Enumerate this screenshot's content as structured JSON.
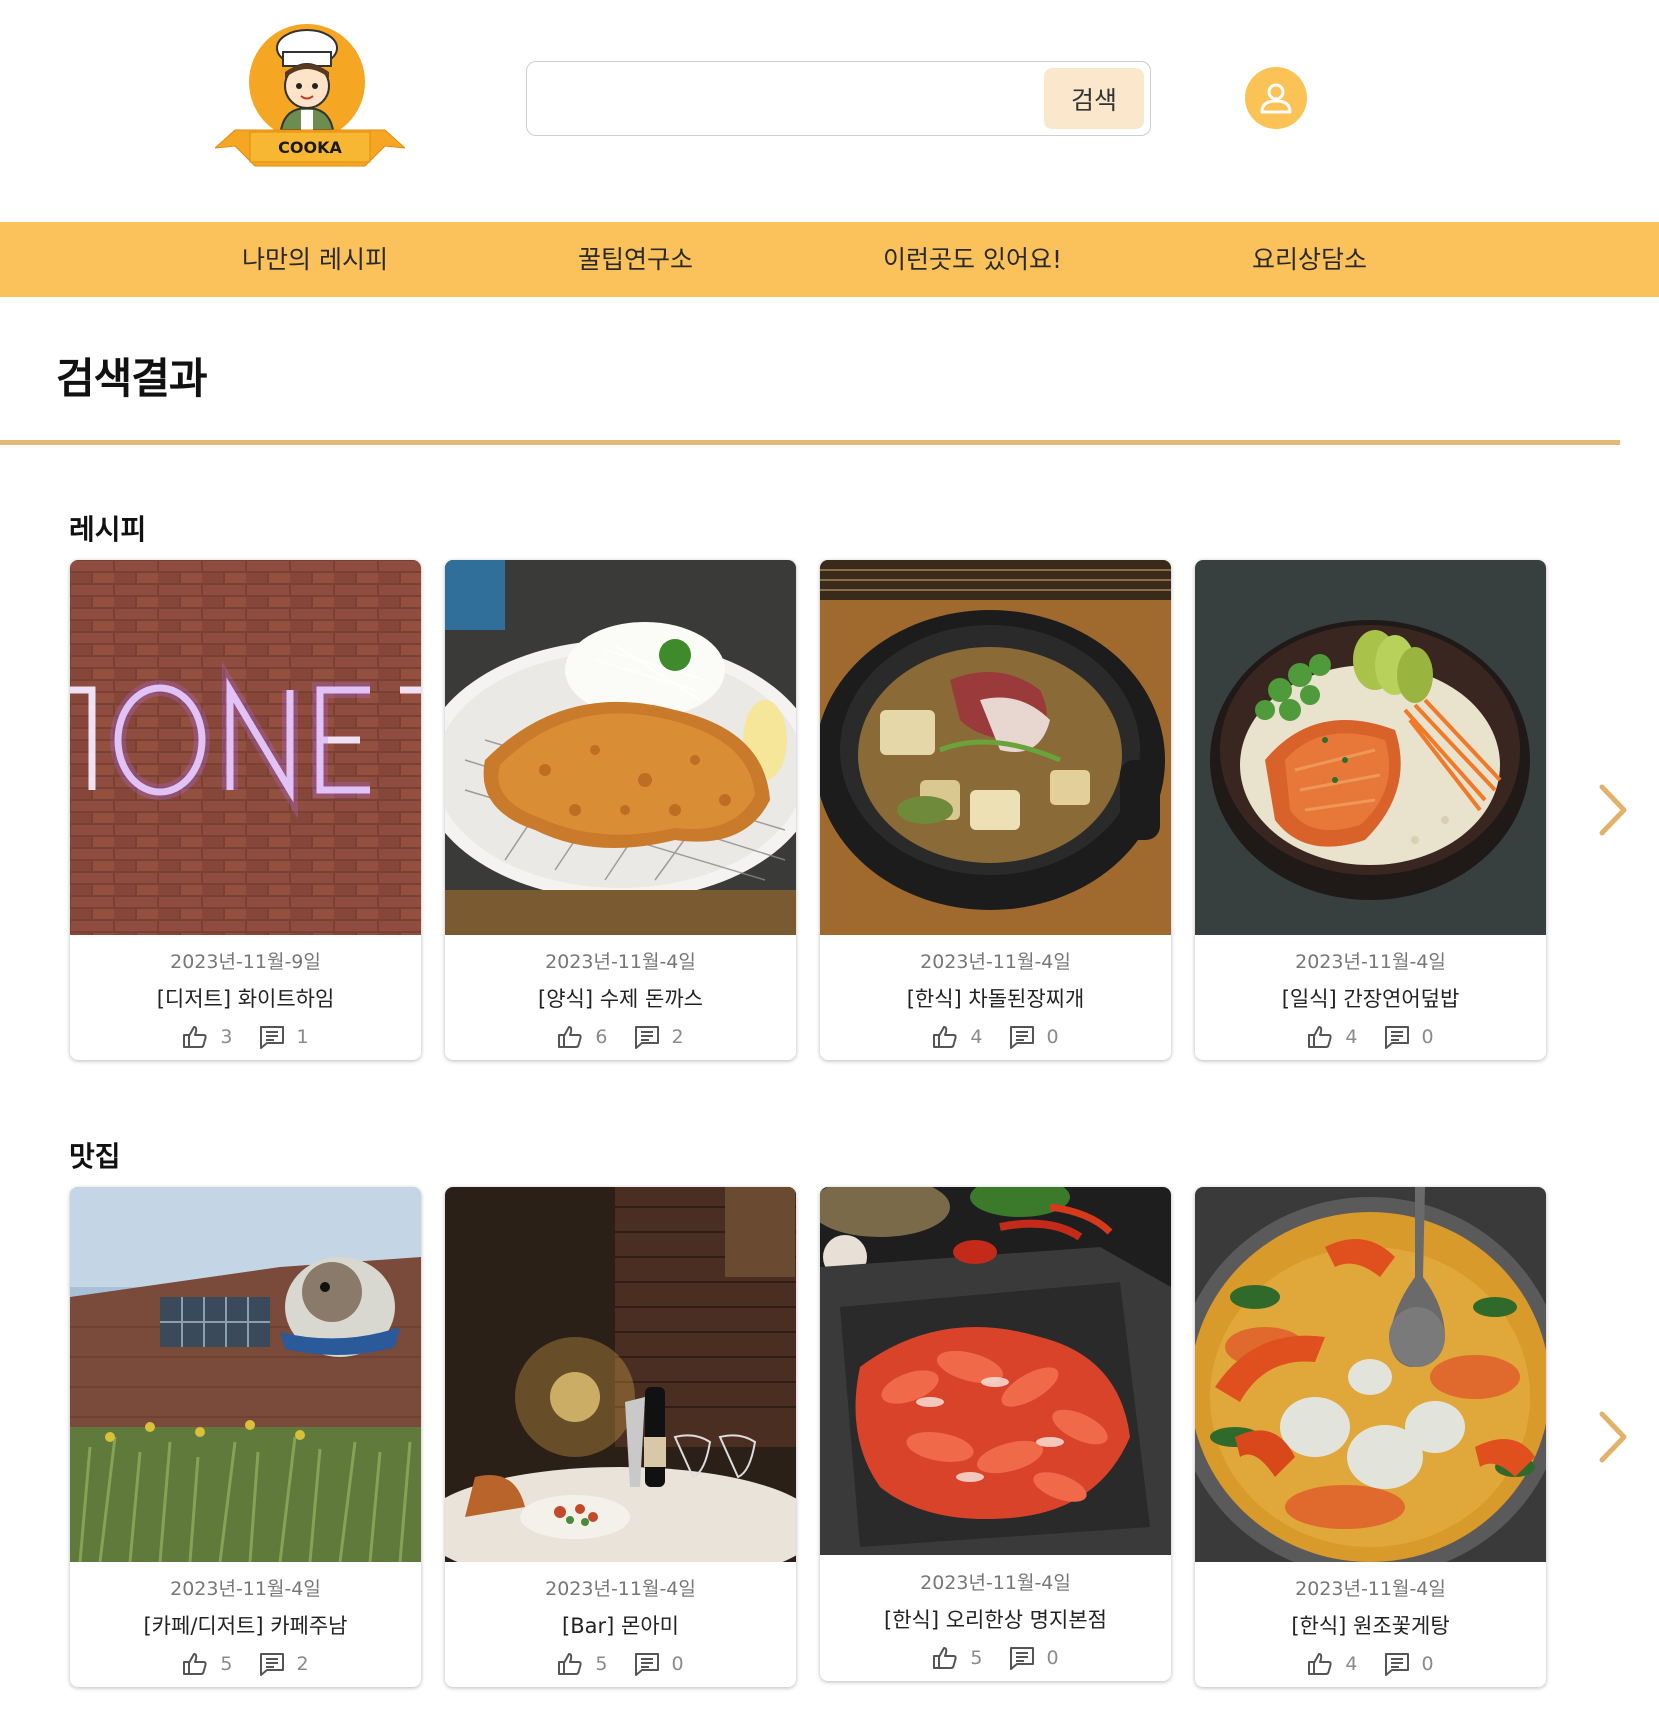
{
  "header": {
    "logo_text": "COOKA",
    "search": {
      "value": "",
      "placeholder": ""
    },
    "search_button": "검색"
  },
  "nav": {
    "items": [
      {
        "label": "나만의 레시피"
      },
      {
        "label": "꿀팁연구소"
      },
      {
        "label": "이런곳도 있어요!"
      },
      {
        "label": "요리상담소"
      }
    ]
  },
  "main": {
    "page_title": "검색결과",
    "sections": [
      {
        "title": "레시피",
        "cards": [
          {
            "date": "2023년-11월-9일",
            "title": "[디저트] 화이트하임",
            "likes": "3",
            "comments": "1",
            "image": "neon-sign-brick-wall"
          },
          {
            "date": "2023년-11월-4일",
            "title": "[양식] 수제 돈까스",
            "likes": "6",
            "comments": "2",
            "image": "pork-cutlet"
          },
          {
            "date": "2023년-11월-4일",
            "title": "[한식] 차돌된장찌개",
            "likes": "4",
            "comments": "0",
            "image": "doenjang-stew"
          },
          {
            "date": "2023년-11월-4일",
            "title": "[일식] 간장연어덮밥",
            "likes": "4",
            "comments": "0",
            "image": "salmon-rice-bowl"
          }
        ]
      },
      {
        "title": "맛집",
        "cards": [
          {
            "date": "2023년-11월-4일",
            "title": "[카페/디저트] 카페주남",
            "likes": "5",
            "comments": "2",
            "image": "cafe-building"
          },
          {
            "date": "2023년-11월-4일",
            "title": "[Bar] 몬아미",
            "likes": "5",
            "comments": "0",
            "image": "bar-interior"
          },
          {
            "date": "2023년-11월-4일",
            "title": "[한식] 오리한상 명지본점",
            "likes": "5",
            "comments": "0",
            "image": "duck-meat-platter"
          },
          {
            "date": "2023년-11월-4일",
            "title": "[한식] 원조꽃게탕",
            "likes": "4",
            "comments": "0",
            "image": "crab-stew"
          }
        ]
      }
    ]
  },
  "colors": {
    "accent": "#fbc25b",
    "divider": "#e3b97a",
    "search_button_bg": "#fbe8cc",
    "arrow": "#e3b26a"
  }
}
